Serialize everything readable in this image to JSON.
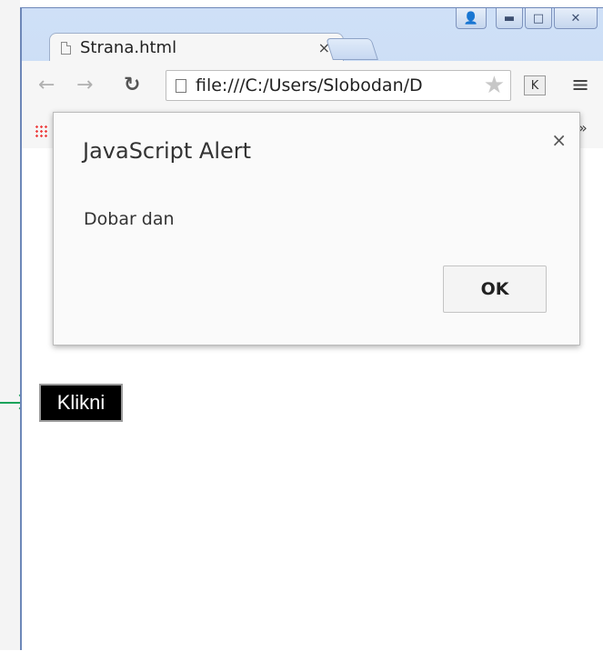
{
  "browser": {
    "tab_title": "Strana.html",
    "tab_close": "×",
    "url": "file:///C:/Users/Slobodan/D",
    "extension_label": "K",
    "bookmarks_overflow": "»"
  },
  "dialog": {
    "title": "JavaScript Alert",
    "message": "Dobar dan",
    "ok_label": "OK",
    "close_label": "×"
  },
  "page": {
    "button_label": "Klikni"
  },
  "colors": {
    "window_frame": "#6d87b8",
    "button_bg": "#000000",
    "button_text": "#ffffff",
    "arrow": "#1aa35a"
  }
}
